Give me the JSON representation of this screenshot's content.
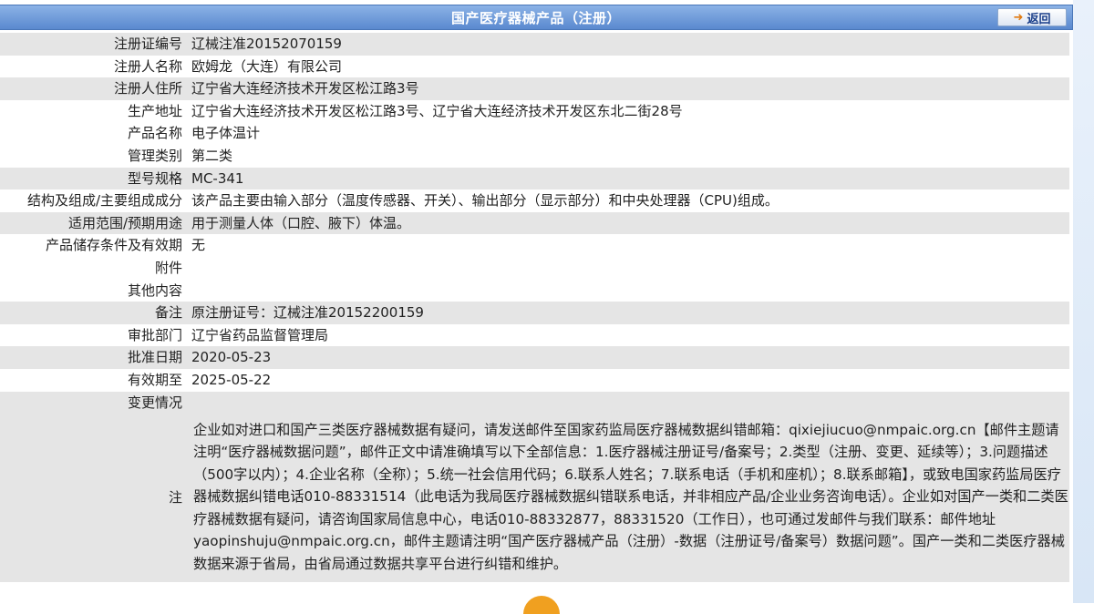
{
  "header": {
    "title": "国产医疗器械产品（注册）",
    "back_label": "返回",
    "back_icon": "arrow-right-icon"
  },
  "rows": [
    {
      "label": "注册证编号",
      "value": "辽械注准20152070159"
    },
    {
      "label": "注册人名称",
      "value": "欧姆龙（大连）有限公司"
    },
    {
      "label": "注册人住所",
      "value": "辽宁省大连经济技术开发区松江路3号"
    },
    {
      "label": "生产地址",
      "value": "辽宁省大连经济技术开发区松江路3号、辽宁省大连经济技术开发区东北二街28号"
    },
    {
      "label": "产品名称",
      "value": "电子体温计"
    },
    {
      "label": "管理类别",
      "value": "第二类"
    },
    {
      "label": "型号规格",
      "value": "MC-341"
    },
    {
      "label": "结构及组成/主要组成成分",
      "value": "该产品主要由输入部分（温度传感器、开关）、输出部分（显示部分）和中央处理器（CPU)组成。"
    },
    {
      "label": "适用范围/预期用途",
      "value": "用于测量人体（口腔、腋下）体温。"
    },
    {
      "label": "产品储存条件及有效期",
      "value": "无"
    },
    {
      "label": "附件",
      "value": ""
    },
    {
      "label": "其他内容",
      "value": ""
    },
    {
      "label": "备注",
      "value": "原注册证号：辽械注准20152200159"
    },
    {
      "label": "审批部门",
      "value": "辽宁省药品监督管理局"
    },
    {
      "label": "批准日期",
      "value": "2020-05-23"
    },
    {
      "label": "有效期至",
      "value": "2025-05-22"
    }
  ],
  "change": {
    "label": "变更情况",
    "value": ""
  },
  "note": {
    "label": "注",
    "text": "企业如对进口和国产三类医疗器械数据有疑问，请发送邮件至国家药监局医疗器械数据纠错邮箱：qixiejiucuo@nmpaic.org.cn【邮件主题请注明“医疗器械数据问题”，邮件正文中请准确填写以下全部信息：1.医疗器械注册证号/备案号；2.类型（注册、变更、延续等）；3.问题描述（500字以内）；4.企业名称（全称）；5.统一社会信用代码；6.联系人姓名；7.联系电话（手机和座机）；8.联系邮箱】，或致电国家药监局医疗器械数据纠错电话010-88331514（此电话为我局医疗器械数据纠错联系电话，并非相应产品/企业业务咨询电话）。企业如对国产一类和二类医疗器械数据有疑问，请咨询国家局信息中心，电话010-88332877，88331520（工作日），也可通过发邮件与我们联系：邮件地址yaopinshuju@nmpaic.org.cn，邮件主题请注明“国产医疗器械产品（注册）-数据（注册证号/备案号）数据问题”。国产一类和二类医疗器械数据来源于省局，由省局通过数据共享平台进行纠错和维护。"
  }
}
